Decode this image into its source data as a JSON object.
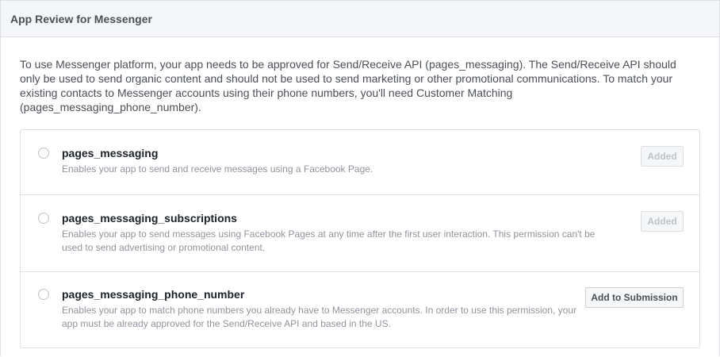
{
  "header": {
    "title": "App Review for Messenger"
  },
  "intro": {
    "text": "To use Messenger platform, your app needs to be approved for Send/Receive API (pages_messaging). The Send/Receive API should only be used to send organic content and should not be used to send marketing or other promotional communications. To match your existing contacts to Messenger accounts using their phone numbers, you'll need Customer Matching (pages_messaging_phone_number)."
  },
  "permissions": [
    {
      "name": "pages_messaging",
      "description": "Enables your app to send and receive messages using a Facebook Page.",
      "button_label": "Added",
      "button_enabled": false,
      "selected": false
    },
    {
      "name": "pages_messaging_subscriptions",
      "description": "Enables your app to send messages using Facebook Pages at any time after the first user interaction. This permission can't be used to send advertising or promotional content.",
      "button_label": "Added",
      "button_enabled": false,
      "selected": false
    },
    {
      "name": "pages_messaging_phone_number",
      "description": "Enables your app to match phone numbers you already have to Messenger accounts. In order to use this permission, your app must be already approved for the Send/Receive API and based in the US.",
      "button_label": "Add to Submission",
      "button_enabled": true,
      "selected": false
    }
  ],
  "colors": {
    "header_bg": "#f5f6f7",
    "border": "#dddfe2",
    "title_text": "#4b4f56",
    "desc_text": "#90949c",
    "disabled_button_text": "#bec2c9"
  }
}
